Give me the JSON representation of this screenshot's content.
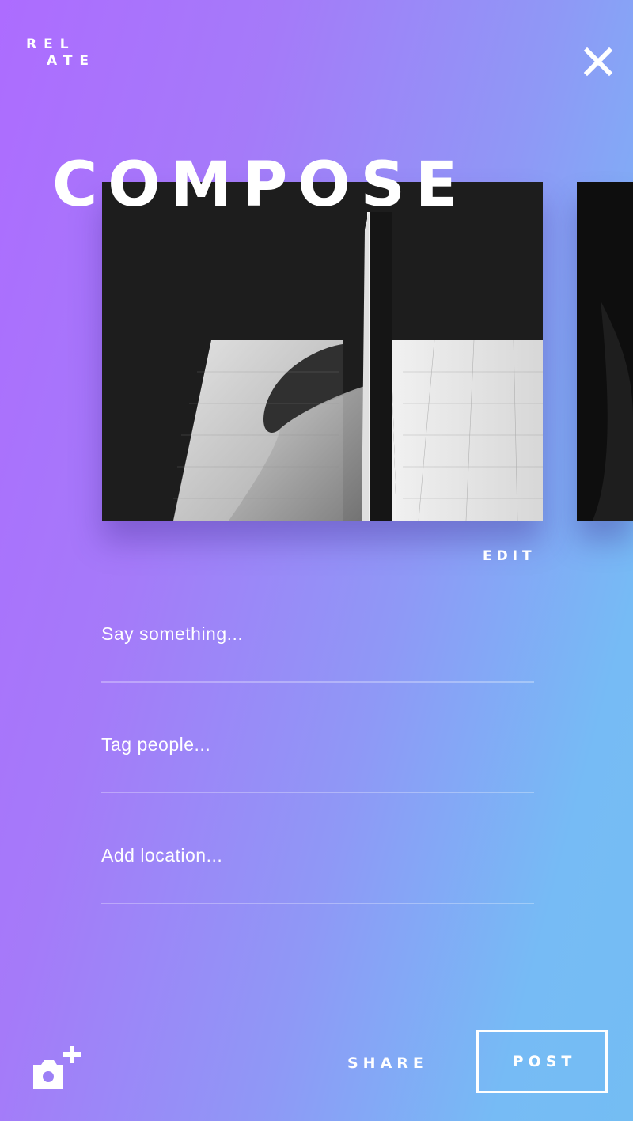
{
  "app": {
    "logo_line1": "REL",
    "logo_line2": "ATE"
  },
  "header": {
    "title": "COMPOSE",
    "close_icon": "close-icon"
  },
  "gallery": {
    "edit_label": "EDIT",
    "photos": [
      {
        "subject": "architecture-photo"
      },
      {
        "subject": "dark-photo"
      }
    ]
  },
  "form": {
    "caption_placeholder": "Say something...",
    "tag_placeholder": "Tag people...",
    "location_placeholder": "Add location..."
  },
  "footer": {
    "camera_icon": "camera-add-icon",
    "share_label": "SHARE",
    "post_label": "POST"
  },
  "colors": {
    "gradient_start": "#ad6cff",
    "gradient_end": "#74bdf3",
    "text": "#ffffff"
  }
}
